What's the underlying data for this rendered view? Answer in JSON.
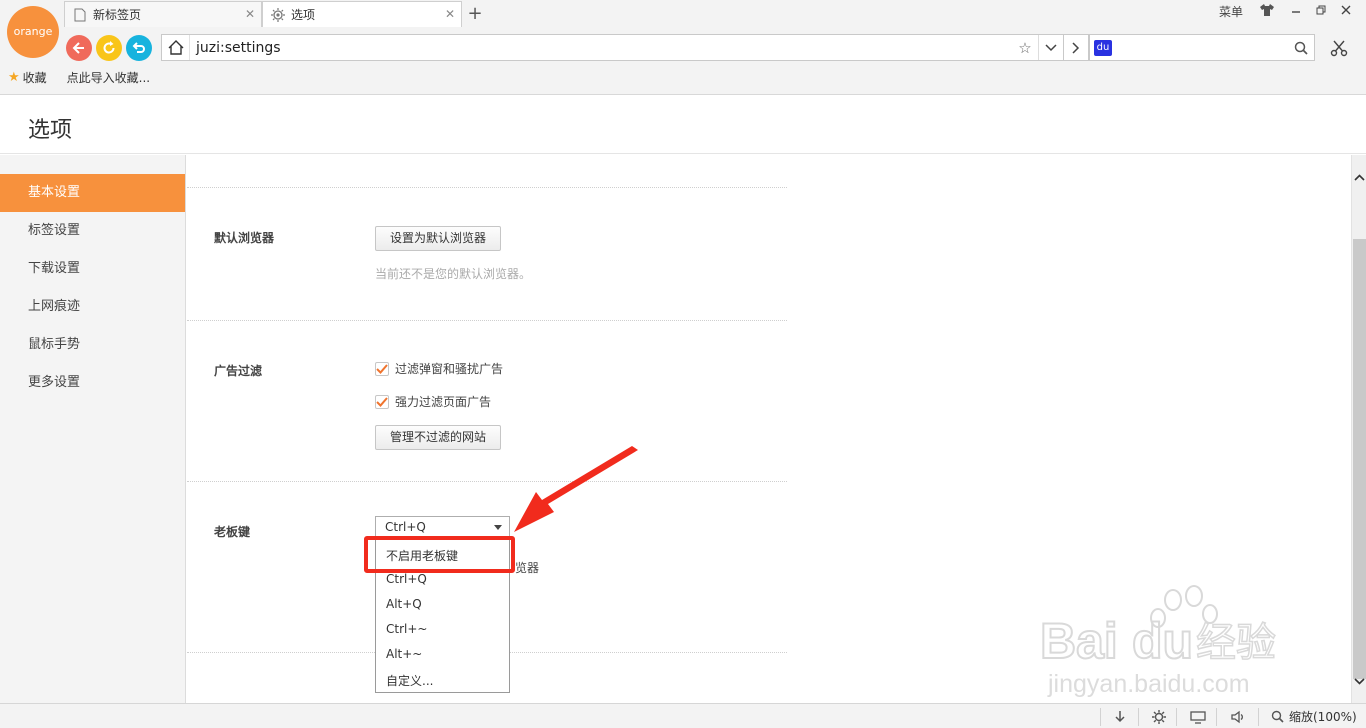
{
  "browser": {
    "logo_text": "orange",
    "tabs": [
      {
        "label": "新标签页",
        "icon": "page-icon"
      },
      {
        "label": "选项",
        "icon": "gear-icon"
      }
    ],
    "menu_label": "菜单",
    "address": "juzi:settings",
    "search_value": "",
    "search_engine_label": "du",
    "favorites_label": "收藏",
    "import_label": "点此导入收藏...",
    "accent_color": "#f7913d"
  },
  "page": {
    "title": "选项"
  },
  "sidebar": {
    "items": [
      {
        "label": "基本设置"
      },
      {
        "label": "标签设置"
      },
      {
        "label": "下载设置"
      },
      {
        "label": "上网痕迹"
      },
      {
        "label": "鼠标手势"
      },
      {
        "label": "更多设置"
      }
    ],
    "active_index": 0
  },
  "sections": {
    "default_browser": {
      "label": "默认浏览器",
      "button": "设置为默认浏览器",
      "hint": "当前还不是您的默认浏览器。"
    },
    "ad_filter": {
      "label": "广告过滤",
      "option1": "过滤弹窗和骚扰广告",
      "option1_checked": true,
      "option2": "强力过滤页面广告",
      "option2_checked": true,
      "button": "管理不过滤的网站"
    },
    "boss_key": {
      "label": "老板键",
      "selected": "Ctrl+Q",
      "behind_text": "览器",
      "options": [
        "不启用老板键",
        "Ctrl+Q",
        "Alt+Q",
        "Ctrl+~",
        "Alt+~",
        "自定义..."
      ]
    }
  },
  "statusbar": {
    "zoom_label": "缩放(100%)"
  },
  "watermark": {
    "brand": "Bai",
    "brand2": "du",
    "cn": "经验",
    "url": "jingyan.baidu.com"
  }
}
